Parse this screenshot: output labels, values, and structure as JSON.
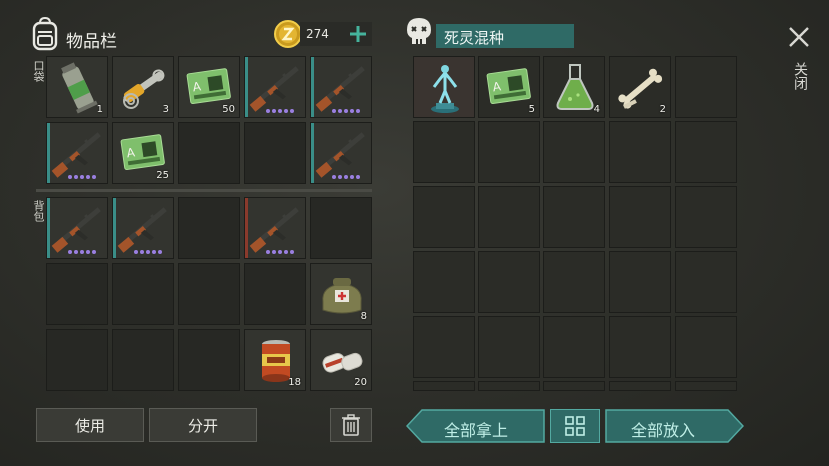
{
  "inventory": {
    "title": "物品栏",
    "coins": "274",
    "pockets_label": "口袋",
    "backpack_label": "背包"
  },
  "pockets": [
    {
      "item": "grenade-canister",
      "count": "1"
    },
    {
      "item": "hydraulic-parts",
      "count": "3"
    },
    {
      "item": "sector-keycard",
      "count": "50"
    },
    {
      "item": "ak-rifle",
      "count": "",
      "quality_dots": 5
    },
    {
      "item": "ak-rifle",
      "count": "",
      "quality_dots": 5
    },
    {
      "item": "ak-rifle",
      "count": "",
      "quality_dots": 5
    },
    {
      "item": "sector-keycard",
      "count": "25"
    },
    {
      "item": "",
      "count": ""
    },
    {
      "item": "",
      "count": ""
    },
    {
      "item": "ak-rifle",
      "count": "",
      "quality_dots": 5
    }
  ],
  "backpack": [
    {
      "item": "ak-rifle",
      "count": "",
      "quality_dots": 5
    },
    {
      "item": "ak-rifle",
      "count": "",
      "quality_dots": 5
    },
    {
      "item": "",
      "count": ""
    },
    {
      "item": "ak-rifle",
      "count": "",
      "quality_dots": 5
    },
    {
      "item": "",
      "count": ""
    },
    {
      "item": "",
      "count": ""
    },
    {
      "item": "",
      "count": ""
    },
    {
      "item": "",
      "count": ""
    },
    {
      "item": "",
      "count": ""
    },
    {
      "item": "medkit-bag",
      "count": "8"
    },
    {
      "item": "",
      "count": ""
    },
    {
      "item": "",
      "count": ""
    },
    {
      "item": "",
      "count": ""
    },
    {
      "item": "canned-food",
      "count": "18"
    },
    {
      "item": "bandages",
      "count": "20"
    }
  ],
  "buttons": {
    "use": "使用",
    "split": "分开",
    "take_all": "全部拿上",
    "put_all": "全部放入"
  },
  "container": {
    "title": "死灵混种",
    "close_label": "关闭",
    "items": [
      {
        "item": "hologram-statue",
        "count": ""
      },
      {
        "item": "sector-keycard",
        "count": "5"
      },
      {
        "item": "green-flask",
        "count": "4"
      },
      {
        "item": "bones",
        "count": "2"
      }
    ]
  },
  "colors": {
    "teal_accent": "#2f6a66",
    "quality_purple": "#9a7fe0",
    "stripe_teal": "#3a8e88",
    "stripe_red": "#8a3a2c"
  }
}
